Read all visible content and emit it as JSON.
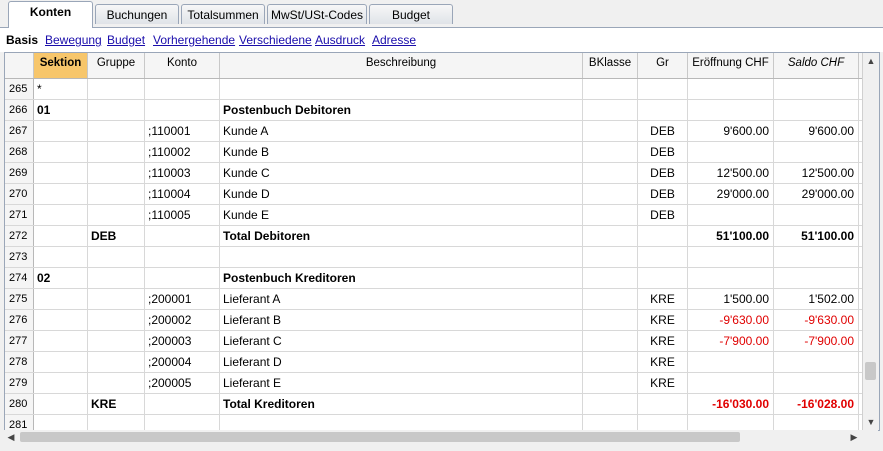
{
  "tabs": [
    "Konten",
    "Buchungen",
    "Totalsummen",
    "MwSt/USt-Codes",
    "Budget"
  ],
  "subtabs": {
    "current": "Basis",
    "links": [
      "Bewegung",
      "Budget",
      "Vorhergehende",
      "Verschiedene",
      "Ausdruck",
      "Adresse"
    ]
  },
  "columns": [
    "Sektion",
    "Gruppe",
    "Konto",
    "Beschreibung",
    "BKlasse",
    "Gr",
    "Eröffnung CHF",
    "Saldo CHF"
  ],
  "selected_column": "Sektion",
  "rows": [
    {
      "n": "265",
      "sektion": "*",
      "gruppe": "",
      "konto": "",
      "beschreibung": "",
      "bklasse": "",
      "gr": "",
      "eroeffnung": "",
      "saldo": ""
    },
    {
      "n": "266",
      "sektion": "01",
      "gruppe": "",
      "konto": "",
      "beschreibung": "Postenbuch Debitoren",
      "bklasse": "",
      "gr": "",
      "eroeffnung": "",
      "saldo": "",
      "bold": true
    },
    {
      "n": "267",
      "sektion": "",
      "gruppe": "",
      "konto": ";110001",
      "beschreibung": "Kunde A",
      "bklasse": "",
      "gr": "DEB",
      "eroeffnung": "9'600.00",
      "saldo": "9'600.00"
    },
    {
      "n": "268",
      "sektion": "",
      "gruppe": "",
      "konto": ";110002",
      "beschreibung": "Kunde B",
      "bklasse": "",
      "gr": "DEB",
      "eroeffnung": "",
      "saldo": ""
    },
    {
      "n": "269",
      "sektion": "",
      "gruppe": "",
      "konto": ";110003",
      "beschreibung": "Kunde C",
      "bklasse": "",
      "gr": "DEB",
      "eroeffnung": "12'500.00",
      "saldo": "12'500.00"
    },
    {
      "n": "270",
      "sektion": "",
      "gruppe": "",
      "konto": ";110004",
      "beschreibung": "Kunde D",
      "bklasse": "",
      "gr": "DEB",
      "eroeffnung": "29'000.00",
      "saldo": "29'000.00"
    },
    {
      "n": "271",
      "sektion": "",
      "gruppe": "",
      "konto": ";110005",
      "beschreibung": "Kunde E",
      "bklasse": "",
      "gr": "DEB",
      "eroeffnung": "",
      "saldo": ""
    },
    {
      "n": "272",
      "sektion": "",
      "gruppe": "DEB",
      "konto": "",
      "beschreibung": "Total Debitoren",
      "bklasse": "",
      "gr": "",
      "eroeffnung": "51'100.00",
      "saldo": "51'100.00",
      "bold": true
    },
    {
      "n": "273",
      "sektion": "",
      "gruppe": "",
      "konto": "",
      "beschreibung": "",
      "bklasse": "",
      "gr": "",
      "eroeffnung": "",
      "saldo": ""
    },
    {
      "n": "274",
      "sektion": "02",
      "gruppe": "",
      "konto": "",
      "beschreibung": "Postenbuch Kreditoren",
      "bklasse": "",
      "gr": "",
      "eroeffnung": "",
      "saldo": "",
      "bold": true
    },
    {
      "n": "275",
      "sektion": "",
      "gruppe": "",
      "konto": ";200001",
      "beschreibung": "Lieferant A",
      "bklasse": "",
      "gr": "KRE",
      "eroeffnung": "1'500.00",
      "saldo": "1'502.00"
    },
    {
      "n": "276",
      "sektion": "",
      "gruppe": "",
      "konto": ";200002",
      "beschreibung": "Lieferant B",
      "bklasse": "",
      "gr": "KRE",
      "eroeffnung": "-9'630.00",
      "saldo": "-9'630.00",
      "neg": true
    },
    {
      "n": "277",
      "sektion": "",
      "gruppe": "",
      "konto": ";200003",
      "beschreibung": "Lieferant C",
      "bklasse": "",
      "gr": "KRE",
      "eroeffnung": "-7'900.00",
      "saldo": "-7'900.00",
      "neg": true
    },
    {
      "n": "278",
      "sektion": "",
      "gruppe": "",
      "konto": ";200004",
      "beschreibung": "Lieferant D",
      "bklasse": "",
      "gr": "KRE",
      "eroeffnung": "",
      "saldo": ""
    },
    {
      "n": "279",
      "sektion": "",
      "gruppe": "",
      "konto": ";200005",
      "beschreibung": "Lieferant E",
      "bklasse": "",
      "gr": "KRE",
      "eroeffnung": "",
      "saldo": ""
    },
    {
      "n": "280",
      "sektion": "",
      "gruppe": "KRE",
      "konto": "",
      "beschreibung": "Total Kreditoren",
      "bklasse": "",
      "gr": "",
      "eroeffnung": "-16'030.00",
      "saldo": "-16'028.00",
      "bold": true,
      "neg": true
    },
    {
      "n": "281",
      "sektion": "",
      "gruppe": "",
      "konto": "",
      "beschreibung": "",
      "bklasse": "",
      "gr": "",
      "eroeffnung": "",
      "saldo": ""
    }
  ],
  "colors": {
    "selected_header": "#f7c66b",
    "negative": "#e00000",
    "link": "#1a0dab"
  },
  "icons": {
    "scroll_up": "chevron-up-icon",
    "scroll_down": "chevron-down-icon",
    "scroll_left": "chevron-left-icon",
    "scroll_right": "chevron-right-icon"
  }
}
